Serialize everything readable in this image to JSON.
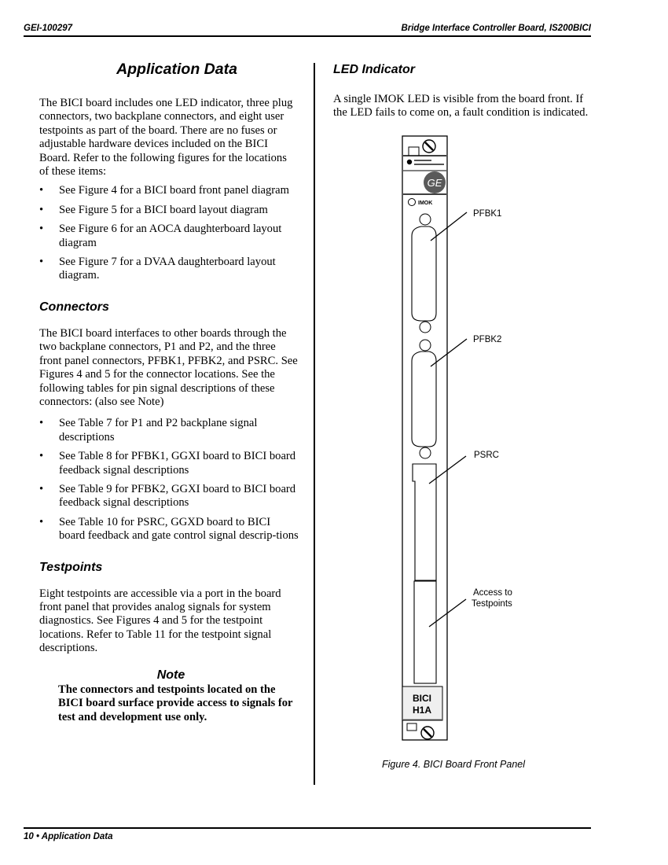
{
  "header": {
    "doc_number": "GEI-100297",
    "doc_title": "Bridge Interface Controller Board, IS200BICI"
  },
  "left_column": {
    "title": "Application Data",
    "intro": "The BICI board includes one LED indicator, three plug connectors, two backplane connectors, and eight user testpoints as part of the board. There are no fuses or adjustable hardware devices included on the BICI Board. Refer to the following figures for the locations of these items:",
    "figure_refs": [
      "See Figure 4 for a BICI board front panel diagram",
      "See Figure 5 for a BICI board layout diagram",
      "See Figure 6 for an AOCA daughterboard layout diagram",
      "See Figure 7 for a DVAA daughterboard layout diagram."
    ],
    "connectors": {
      "heading": "Connectors",
      "body": "The BICI board interfaces to other boards through the two backplane connectors, P1 and P2, and the three front panel connectors, PFBK1, PFBK2, and PSRC. See Figures 4 and 5 for the connector locations. See the following tables for pin signal descriptions of these connectors:  (also see Note)",
      "table_refs": [
        "See Table 7 for P1 and P2 backplane signal descriptions",
        "See Table 8 for PFBK1, GGXI board to BICI board feedback signal descriptions",
        "See Table 9 for PFBK2, GGXI board to BICI board feedback signal descriptions",
        "See Table 10 for PSRC, GGXD board to BICI board feedback and gate control signal descrip-tions"
      ]
    },
    "testpoints": {
      "heading": "Testpoints",
      "body": "Eight testpoints are accessible via a port in the board front panel that provides analog signals for system diagnostics. See Figures 4 and 5 for the testpoint locations. Refer to Table 11 for the testpoint signal descriptions."
    },
    "note": {
      "heading": "Note",
      "body": "The connectors and testpoints located on the BICI board surface provide access to signals for test and development use only."
    },
    "bullet": "•"
  },
  "right_column": {
    "heading": "LED Indicator",
    "body": "A single IMOK LED is visible from the board front. If the LED fails to come on, a fault condition is indicated.",
    "figure": {
      "led_label": "IMOK",
      "callouts": [
        "PFBK1",
        "PFBK2",
        "PSRC",
        "Access to",
        "Testpoints"
      ],
      "board_label_line1": "BICI",
      "board_label_line2": "H1A",
      "caption": "Figure 4.  BICI Board Front Panel"
    }
  },
  "footer": {
    "page_label": "10 • Application Data"
  }
}
